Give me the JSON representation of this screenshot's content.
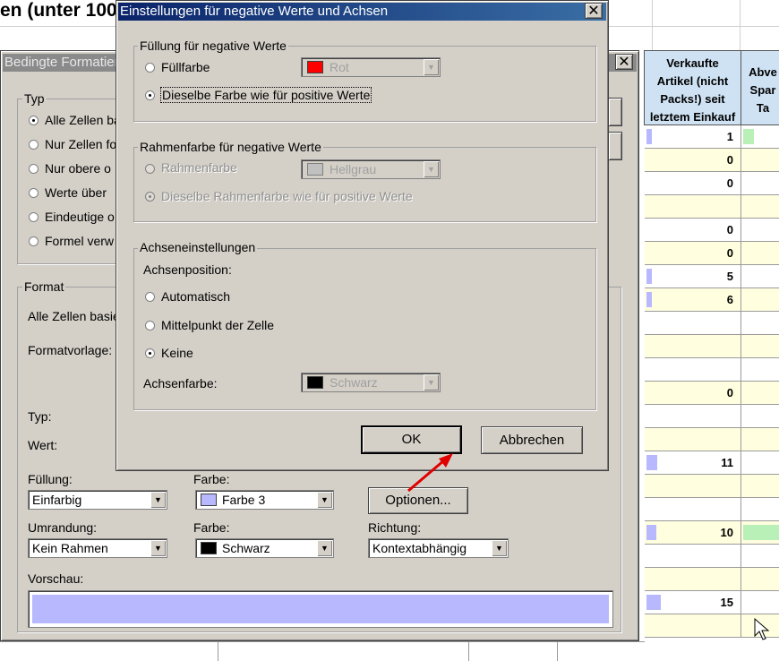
{
  "sheet": {
    "title": "en (unter 100",
    "header_col1": [
      "Verkaufte",
      "Artikel (nicht",
      "Packs!) seit",
      "letztem Einkauf"
    ],
    "header_col2": [
      "Abve",
      "Spar",
      "Ta"
    ],
    "rows": [
      {
        "value": "1",
        "bar": 0.05,
        "green": true
      },
      {
        "value": "0",
        "bar": 0
      },
      {
        "value": "0",
        "bar": 0
      },
      {
        "value": "",
        "bar": 0
      },
      {
        "value": "0",
        "bar": 0
      },
      {
        "value": "0",
        "bar": 0
      },
      {
        "value": "5",
        "bar": 0.05
      },
      {
        "value": "6",
        "bar": 0.06
      },
      {
        "value": "",
        "bar": 0
      },
      {
        "value": "",
        "bar": 0
      },
      {
        "value": "",
        "bar": 0
      },
      {
        "value": "0",
        "bar": 0
      },
      {
        "value": "",
        "bar": 0
      },
      {
        "value": "",
        "bar": 0
      },
      {
        "value": "11",
        "bar": 0.11
      },
      {
        "value": "",
        "bar": 0
      },
      {
        "value": "",
        "bar": 0
      },
      {
        "value": "10",
        "bar": 0.1,
        "green": true
      },
      {
        "value": "",
        "bar": 0
      },
      {
        "value": "",
        "bar": 0
      },
      {
        "value": "15",
        "bar": 0.15
      },
      {
        "value": "",
        "bar": 0
      }
    ]
  },
  "back_dialog": {
    "title": "Bedingte Formatier",
    "type_group_label": "Typ",
    "type_options": [
      "Alle Zellen ba",
      "Nur Zellen fo",
      "Nur obere o",
      "Werte über",
      "Eindeutige o",
      "Formel verw"
    ],
    "format_group_label": "Format",
    "format_desc": "Alle Zellen basie",
    "formatvorlage_label": "Formatvorlage:",
    "typ_label": "Typ:",
    "wert_label": "Wert:",
    "fuellung_label": "Füllung:",
    "fuellung_value": "Einfarbig",
    "farbe1_label": "Farbe:",
    "farbe1_value": "Farbe 3",
    "farbe1_color": "#b8b8ff",
    "optionen_button": "Optionen...",
    "umrandung_label": "Umrandung:",
    "umrandung_value": "Kein Rahmen",
    "farbe2_label": "Farbe:",
    "farbe2_value": "Schwarz",
    "farbe2_color": "#000000",
    "richtung_label": "Richtung:",
    "richtung_value": "Kontextabhängig",
    "vorschau_label": "Vorschau:",
    "vorschau_color": "#b8b8ff",
    "close_symbol": "✕"
  },
  "dialog": {
    "title": "Einstellungen für negative Werte und Achsen",
    "close_symbol": "✕",
    "fill_group_label": "Füllung für negative Werte",
    "fill_option1": "Füllfarbe",
    "fill_color_value": "Rot",
    "fill_color": "#ff0000",
    "fill_option2": "Dieselbe Farbe wie für positive Werte",
    "border_group_label": "Rahmenfarbe für negative Werte",
    "border_option1": "Rahmenfarbe",
    "border_color_value": "Hellgrau",
    "border_color": "#c0c0c0",
    "border_option2": "Dieselbe Rahmenfarbe wie für positive Werte",
    "axis_group_label": "Achseneinstellungen",
    "axis_position_label": "Achsenposition:",
    "axis_option1": "Automatisch",
    "axis_option2": "Mittelpunkt der Zelle",
    "axis_option3": "Keine",
    "axis_color_label": "Achsenfarbe:",
    "axis_color_value": "Schwarz",
    "axis_color": "#000000",
    "ok_button": "OK",
    "cancel_button": "Abbrechen"
  }
}
